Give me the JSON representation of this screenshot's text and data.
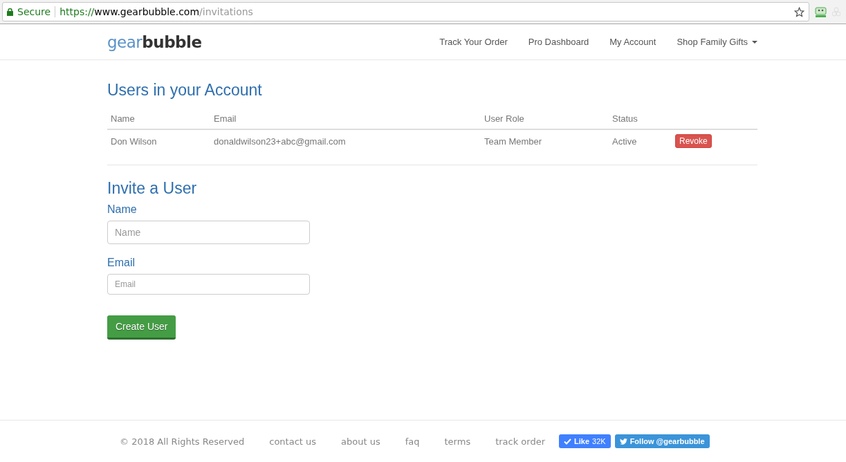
{
  "browser": {
    "security": "Secure",
    "url_scheme": "https://",
    "url_host": "www.gearbubble.com",
    "url_path": "/invitations"
  },
  "logo": {
    "light": "gear",
    "bold": "bubble"
  },
  "nav": [
    {
      "label": "Track Your Order",
      "dropdown": false
    },
    {
      "label": "Pro Dashboard",
      "dropdown": false
    },
    {
      "label": "My Account",
      "dropdown": false
    },
    {
      "label": "Shop Family Gifts",
      "dropdown": true
    }
  ],
  "users": {
    "title": "Users in your Account",
    "columns": [
      "Name",
      "Email",
      "User Role",
      "Status"
    ],
    "rows": [
      {
        "name": "Don Wilson",
        "email": "donaldwilson23+abc@gmail.com",
        "role": "Team Member",
        "status": "Active",
        "action": "Revoke"
      }
    ]
  },
  "invite": {
    "title": "Invite a User",
    "fields": [
      {
        "label": "Name",
        "placeholder": "Name",
        "kind": "large"
      },
      {
        "label": "Email",
        "placeholder": "Email",
        "kind": "small"
      }
    ],
    "submit": "Create User"
  },
  "footer": {
    "copyright": "© 2018 All Rights Reserved",
    "links": [
      "contact us",
      "about us",
      "faq",
      "terms",
      "track order"
    ],
    "like": "Like",
    "like_count": "32K",
    "follow": "Follow @gearbubble"
  }
}
